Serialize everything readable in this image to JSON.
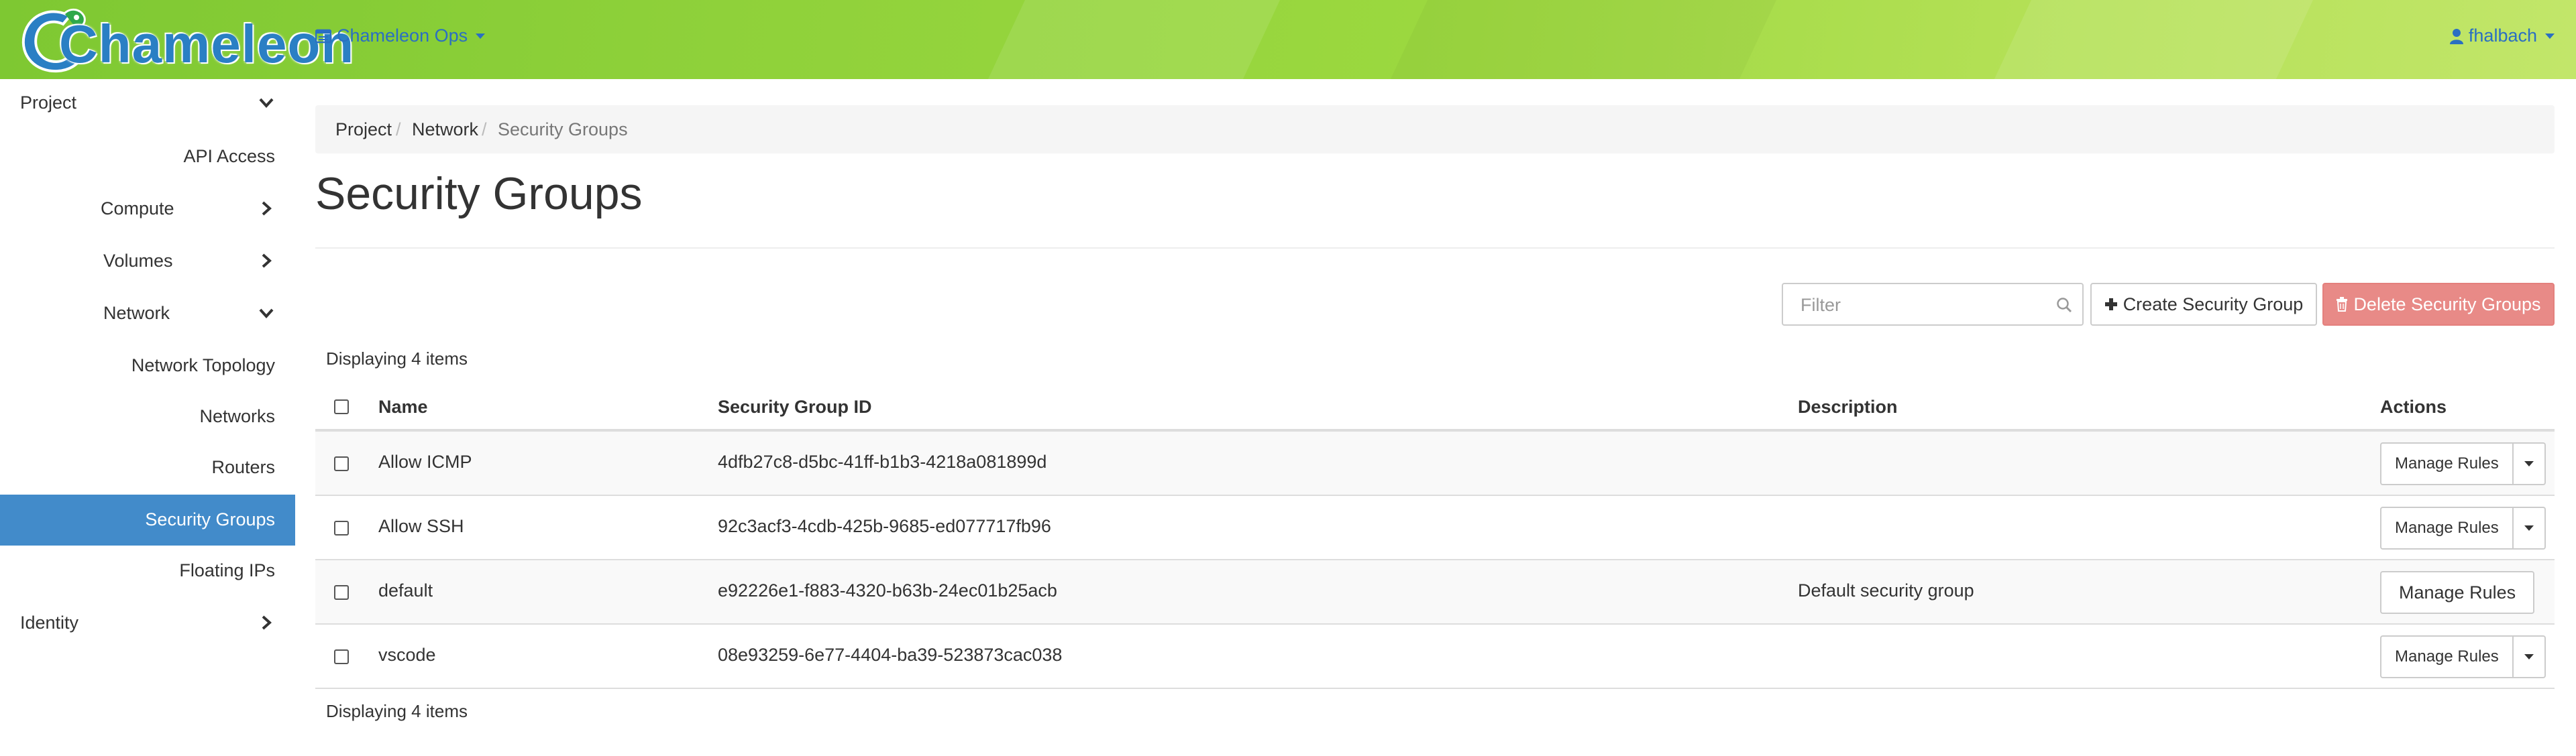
{
  "app": {
    "brand": "Chameleon",
    "project_menu_label": "Chameleon Ops",
    "user_menu_label": "fhalbach",
    "accent_color": "#428bca",
    "topbar_color": "#8fd13a"
  },
  "sidebar": {
    "items": [
      {
        "label": "Project",
        "icon": "chevron-down-icon"
      },
      {
        "label": "API Access"
      },
      {
        "label": "Compute",
        "icon": "chevron-right-icon"
      },
      {
        "label": "Volumes",
        "icon": "chevron-right-icon"
      },
      {
        "label": "Network",
        "icon": "chevron-down-icon"
      },
      {
        "label": "Network Topology"
      },
      {
        "label": "Networks"
      },
      {
        "label": "Routers"
      },
      {
        "label": "Security Groups",
        "active": true
      },
      {
        "label": "Floating IPs"
      },
      {
        "label": "Identity",
        "icon": "chevron-right-icon"
      }
    ]
  },
  "breadcrumb": {
    "items": [
      "Project",
      "Network",
      "Security Groups"
    ],
    "separator": "/"
  },
  "page": {
    "title": "Security Groups"
  },
  "toolbar": {
    "filter_placeholder": "Filter",
    "create_label": "Create Security Group",
    "delete_label": "Delete Security Groups"
  },
  "table": {
    "count_text": "Displaying 4 items",
    "columns": [
      "Name",
      "Security Group ID",
      "Description",
      "Actions"
    ],
    "rows": [
      {
        "name": "Allow ICMP",
        "id": "4dfb27c8-d5bc-41ff-b1b3-4218a081899d",
        "description": "",
        "action": "Manage Rules"
      },
      {
        "name": "Allow SSH",
        "id": "92c3acf3-4cdb-425b-9685-ed077717fb96",
        "description": "",
        "action": "Manage Rules"
      },
      {
        "name": "default",
        "id": "e92226e1-f883-4320-b63b-24ec01b25acb",
        "description": "Default security group",
        "action": "Manage Rules"
      },
      {
        "name": "vscode",
        "id": "08e93259-6e77-4404-ba39-523873cac038",
        "description": "",
        "action": "Manage Rules"
      }
    ]
  }
}
